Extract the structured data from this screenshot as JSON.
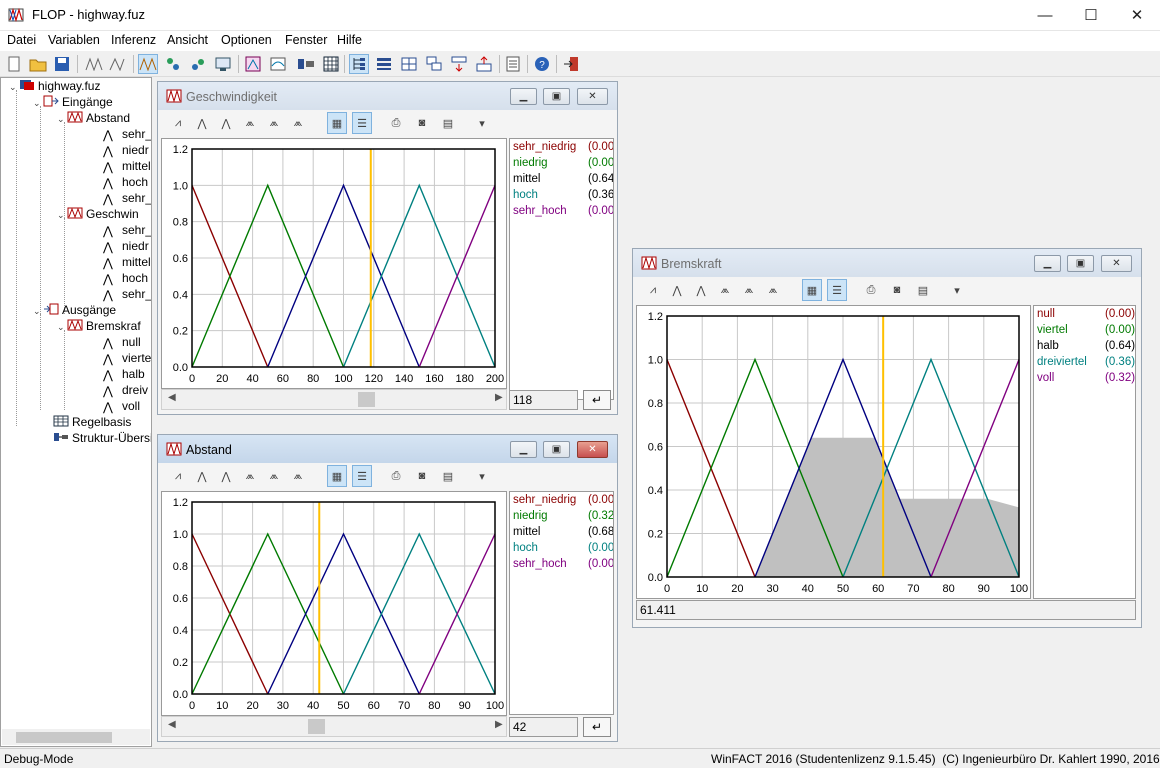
{
  "app": {
    "title": "FLOP - highway.fuz",
    "minimize": "—",
    "maximize": "☐",
    "close": "✕"
  },
  "menu": [
    "Datei",
    "Variablen",
    "Inferenz",
    "Ansicht",
    "Optionen",
    "Fenster",
    "Hilfe"
  ],
  "toolbar": {
    "icons": [
      "new-file-icon",
      "open-folder-icon",
      "save-icon",
      "variables-icon",
      "terms-icon",
      "inference-icon",
      "rule-icon",
      "rule-edit-icon",
      "rule-monitor-icon",
      "defuzz-icon",
      "surface-icon",
      "table-icon",
      "grid-icon",
      "tree-view-icon",
      "list-view-icon",
      "split-view-icon",
      "cascade-icon",
      "tile-icon",
      "arrange-icon",
      "properties-icon",
      "help-icon",
      "exit-icon"
    ]
  },
  "tree": {
    "root": "highway.fuz",
    "inputs_label": "Eingänge",
    "input_vars": [
      {
        "name": "Abstand",
        "terms": [
          "sehr_",
          "niedr",
          "mittel",
          "hoch",
          "sehr_"
        ]
      },
      {
        "name": "Geschwin",
        "terms": [
          "sehr_",
          "niedr",
          "mittel",
          "hoch",
          "sehr_"
        ]
      }
    ],
    "outputs_label": "Ausgänge",
    "output_vars": [
      {
        "name": "Bremskraf",
        "terms": [
          "null",
          "vierte",
          "halb",
          "dreiv",
          "voll"
        ]
      }
    ],
    "rulebase": "Regelbasis",
    "structure": "Struktur-Übersic"
  },
  "colors": {
    "term1": "#8b0000",
    "term2": "#007a00",
    "term3": "#000080",
    "term4": "#008080",
    "term5": "#800080",
    "cursor": "#ffc000",
    "fill": "#c0c0c0"
  },
  "windows": {
    "geschwindigkeit": {
      "title": "Geschwindigkeit",
      "value": "118",
      "enter": "↵",
      "legend": [
        {
          "term": "sehr_niedrig",
          "val": "(0.00"
        },
        {
          "term": "niedrig",
          "val": "(0.00"
        },
        {
          "term": "mittel",
          "val": "(0.64"
        },
        {
          "term": "hoch",
          "val": "(0.36"
        },
        {
          "term": "sehr_hoch",
          "val": "(0.00"
        }
      ]
    },
    "abstand": {
      "title": "Abstand",
      "value": "42",
      "enter": "↵",
      "legend": [
        {
          "term": "sehr_niedrig",
          "val": "(0.00"
        },
        {
          "term": "niedrig",
          "val": "(0.32"
        },
        {
          "term": "mittel",
          "val": "(0.68"
        },
        {
          "term": "hoch",
          "val": "(0.00"
        },
        {
          "term": "sehr_hoch",
          "val": "(0.00"
        }
      ]
    },
    "bremskraft": {
      "title": "Bremskraft",
      "value": "61.411",
      "legend": [
        {
          "term": "null",
          "val": "(0.00)"
        },
        {
          "term": "viertel",
          "val": "(0.00)"
        },
        {
          "term": "halb",
          "val": "(0.64)"
        },
        {
          "term": "dreiviertel",
          "val": "(0.36)"
        },
        {
          "term": "voll",
          "val": "(0.32)"
        }
      ]
    }
  },
  "chart_data": [
    {
      "type": "line",
      "name": "Geschwindigkeit",
      "xlim": [
        0,
        200
      ],
      "ylim": [
        0,
        1.2
      ],
      "xticks": [
        0,
        20,
        40,
        60,
        80,
        100,
        120,
        140,
        160,
        180,
        200
      ],
      "yticks": [
        0.0,
        0.2,
        0.4,
        0.6,
        0.8,
        1.0,
        1.2
      ],
      "grid": true,
      "series": [
        {
          "name": "sehr_niedrig",
          "x": [
            0,
            50
          ],
          "y": [
            1,
            0
          ]
        },
        {
          "name": "niedrig",
          "x": [
            0,
            50,
            100
          ],
          "y": [
            0,
            1,
            0
          ]
        },
        {
          "name": "mittel",
          "x": [
            50,
            100,
            150
          ],
          "y": [
            0,
            1,
            0
          ]
        },
        {
          "name": "hoch",
          "x": [
            100,
            150,
            200
          ],
          "y": [
            0,
            1,
            0
          ]
        },
        {
          "name": "sehr_hoch",
          "x": [
            150,
            200
          ],
          "y": [
            0,
            1
          ]
        }
      ],
      "cursor_x": 118
    },
    {
      "type": "line",
      "name": "Abstand",
      "xlim": [
        0,
        100
      ],
      "ylim": [
        0,
        1.2
      ],
      "xticks": [
        0,
        10,
        20,
        30,
        40,
        50,
        60,
        70,
        80,
        90,
        100
      ],
      "yticks": [
        0.0,
        0.2,
        0.4,
        0.6,
        0.8,
        1.0,
        1.2
      ],
      "grid": true,
      "series": [
        {
          "name": "sehr_niedrig",
          "x": [
            0,
            25
          ],
          "y": [
            1,
            0
          ]
        },
        {
          "name": "niedrig",
          "x": [
            0,
            25,
            50
          ],
          "y": [
            0,
            1,
            0
          ]
        },
        {
          "name": "mittel",
          "x": [
            25,
            50,
            75
          ],
          "y": [
            0,
            1,
            0
          ]
        },
        {
          "name": "hoch",
          "x": [
            50,
            75,
            100
          ],
          "y": [
            0,
            1,
            0
          ]
        },
        {
          "name": "sehr_hoch",
          "x": [
            75,
            100
          ],
          "y": [
            0,
            1
          ]
        }
      ],
      "cursor_x": 42
    },
    {
      "type": "area",
      "name": "Bremskraft",
      "xlim": [
        0,
        100
      ],
      "ylim": [
        0,
        1.2
      ],
      "xticks": [
        0,
        10,
        20,
        30,
        40,
        50,
        60,
        70,
        80,
        90,
        100
      ],
      "yticks": [
        0.0,
        0.2,
        0.4,
        0.6,
        0.8,
        1.0,
        1.2
      ],
      "grid": true,
      "series": [
        {
          "name": "null",
          "x": [
            0,
            25
          ],
          "y": [
            1,
            0
          ]
        },
        {
          "name": "viertel",
          "x": [
            0,
            25,
            50
          ],
          "y": [
            0,
            1,
            0
          ]
        },
        {
          "name": "halb",
          "x": [
            25,
            50,
            75
          ],
          "y": [
            0,
            1,
            0
          ]
        },
        {
          "name": "dreiviertel",
          "x": [
            50,
            75,
            100
          ],
          "y": [
            0,
            1,
            0
          ]
        },
        {
          "name": "voll",
          "x": [
            75,
            100
          ],
          "y": [
            0,
            1
          ]
        }
      ],
      "aggregate": {
        "x": [
          25,
          41,
          59,
          66,
          91,
          100
        ],
        "y": [
          0,
          0.64,
          0.64,
          0.36,
          0.36,
          0.32
        ]
      },
      "cursor_x": 61.411
    }
  ]
}
